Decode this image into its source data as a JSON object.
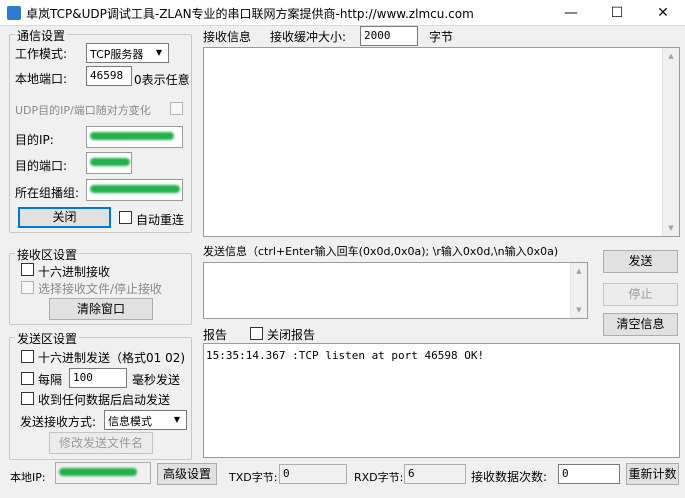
{
  "window": {
    "title": "卓岚TCP&UDP调试工具-ZLAN专业的串口联网方案提供商-http://www.zlmcu.com",
    "min_glyph": "—",
    "max_glyph": "☐",
    "close_glyph": "✕"
  },
  "comm": {
    "group_label": "通信设置",
    "mode_label": "工作模式:",
    "mode_value": "TCP服务器",
    "port_label": "本地端口:",
    "port_value": "46598",
    "port_hint": "0表示任意",
    "udp_label": "UDP目的IP/端口随对方变化",
    "dest_ip_label": "目的IP:",
    "dest_port_label": "目的端口:",
    "group_addr_label": "所在组播组:",
    "close_button": "关闭",
    "auto_reconnect_label": "自动重连"
  },
  "recv_settings": {
    "group_label": "接收区设置",
    "hex_recv_label": "十六进制接收",
    "choose_file_label": "选择接收文件/停止接收",
    "clear_button": "清除窗口"
  },
  "send_settings": {
    "group_label": "发送区设置",
    "hex_send_label": "十六进制发送（格式01 02)",
    "every_label": "每隔",
    "interval_value": "100",
    "interval_unit": "毫秒发送",
    "auto_send_label": "收到任何数据后启动发送",
    "mode_label": "发送接收方式:",
    "mode_value": "信息模式",
    "modify_filename_button": "修改发送文件名"
  },
  "recv_area": {
    "label": "接收信息",
    "buffer_label": "接收缓冲大小:",
    "buffer_value": "2000",
    "buffer_unit": "字节"
  },
  "send_area": {
    "label": "发送信息（ctrl+Enter输入回车(0x0d,0x0a); \\r输入0x0d,\\n输入0x0a)",
    "send_button": "发送",
    "stop_button": "停止",
    "clear_info_button": "清空信息"
  },
  "report": {
    "label": "报告",
    "close_report_label": "关闭报告",
    "log_line": "15:35:14.367 :TCP listen at port 46598 OK!"
  },
  "status": {
    "local_ip_label": "本地IP:",
    "advanced_button": "高级设置",
    "txd_label": "TXD字节:",
    "txd_value": "0",
    "rxd_label": "RXD字节:",
    "rxd_value": "6",
    "recv_count_label": "接收数据次数:",
    "recv_count_value": "0",
    "recount_button": "重新计数"
  },
  "colors": {
    "redaction": "#22b14c",
    "accent": "#0078d7",
    "background": "#f0f0f0"
  }
}
